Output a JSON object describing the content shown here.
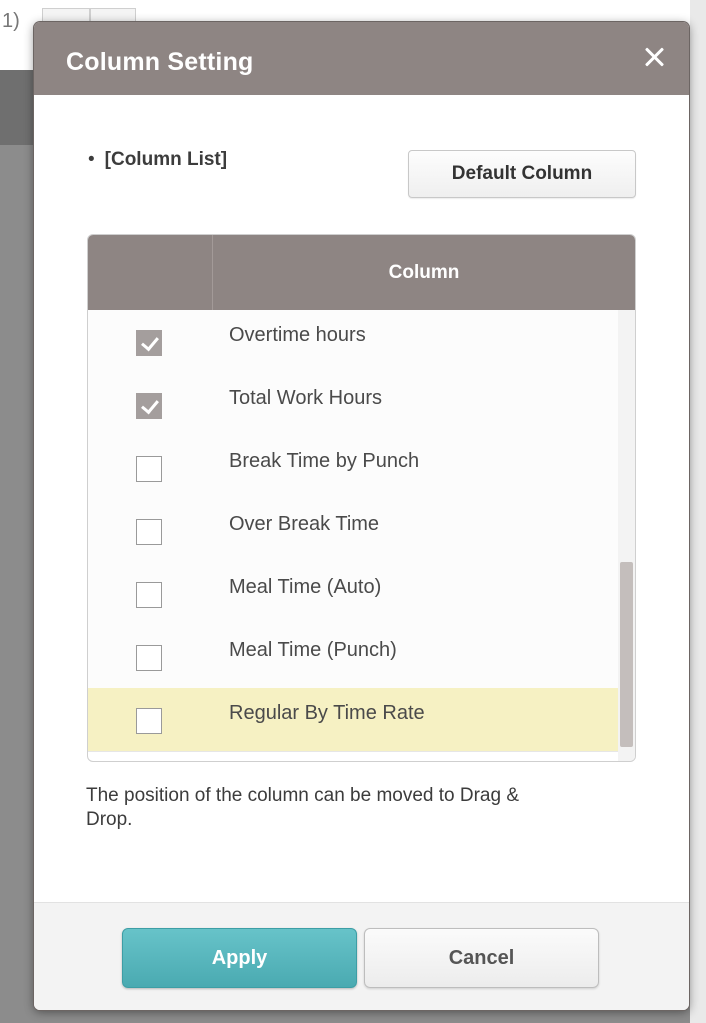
{
  "background": {
    "fragment_text": "1)"
  },
  "dialog": {
    "title": "Column Setting",
    "close_icon": "close-icon"
  },
  "section": {
    "bullet": "•",
    "label": "[Column List]",
    "default_button_label": "Default Column"
  },
  "grid": {
    "column_header": "Column",
    "rows": [
      {
        "label": "Overtime hours",
        "checked": true,
        "highlighted": false
      },
      {
        "label": "Total Work Hours",
        "checked": true,
        "highlighted": false
      },
      {
        "label": "Break Time by Punch",
        "checked": false,
        "highlighted": false
      },
      {
        "label": "Over Break Time",
        "checked": false,
        "highlighted": false
      },
      {
        "label": "Meal Time (Auto)",
        "checked": false,
        "highlighted": false
      },
      {
        "label": "Meal Time (Punch)",
        "checked": false,
        "highlighted": false
      },
      {
        "label": "Regular By Time Rate",
        "checked": false,
        "highlighted": true
      }
    ]
  },
  "help_text": "The position of the column can be moved to Drag & Drop.",
  "footer": {
    "apply_label": "Apply",
    "cancel_label": "Cancel"
  },
  "colors": {
    "header_bg": "#8e8583",
    "apply_accent": "#4aaab1",
    "highlight_row": "#f6f1c3",
    "checked_box": "#a49e9d"
  }
}
